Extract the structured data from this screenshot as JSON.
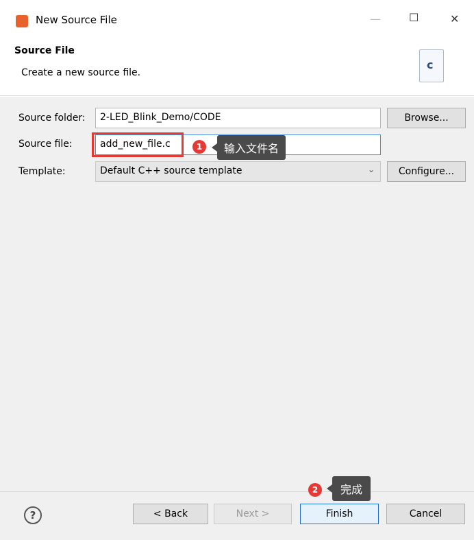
{
  "window": {
    "title": "New Source File",
    "minimize_glyph": "—",
    "maximize_glyph": "☐",
    "close_glyph": "✕"
  },
  "header": {
    "title": "Source File",
    "description": "Create a new source file.",
    "icon_letter": "c"
  },
  "form": {
    "source_folder_label": "Source folder:",
    "source_folder_value": "2-LED_Blink_Demo/CODE",
    "browse_label": "Browse...",
    "source_file_label": "Source file:",
    "source_file_value": "add_new_file.c",
    "template_label": "Template:",
    "template_value": "Default C++ source template",
    "configure_label": "Configure..."
  },
  "annotations": {
    "step1_number": "1",
    "step1_text": "输入文件名",
    "step2_number": "2",
    "step2_text": "完成"
  },
  "footer": {
    "help_glyph": "?",
    "back_label": "< Back",
    "next_label": "Next >",
    "finish_label": "Finish",
    "cancel_label": "Cancel"
  }
}
